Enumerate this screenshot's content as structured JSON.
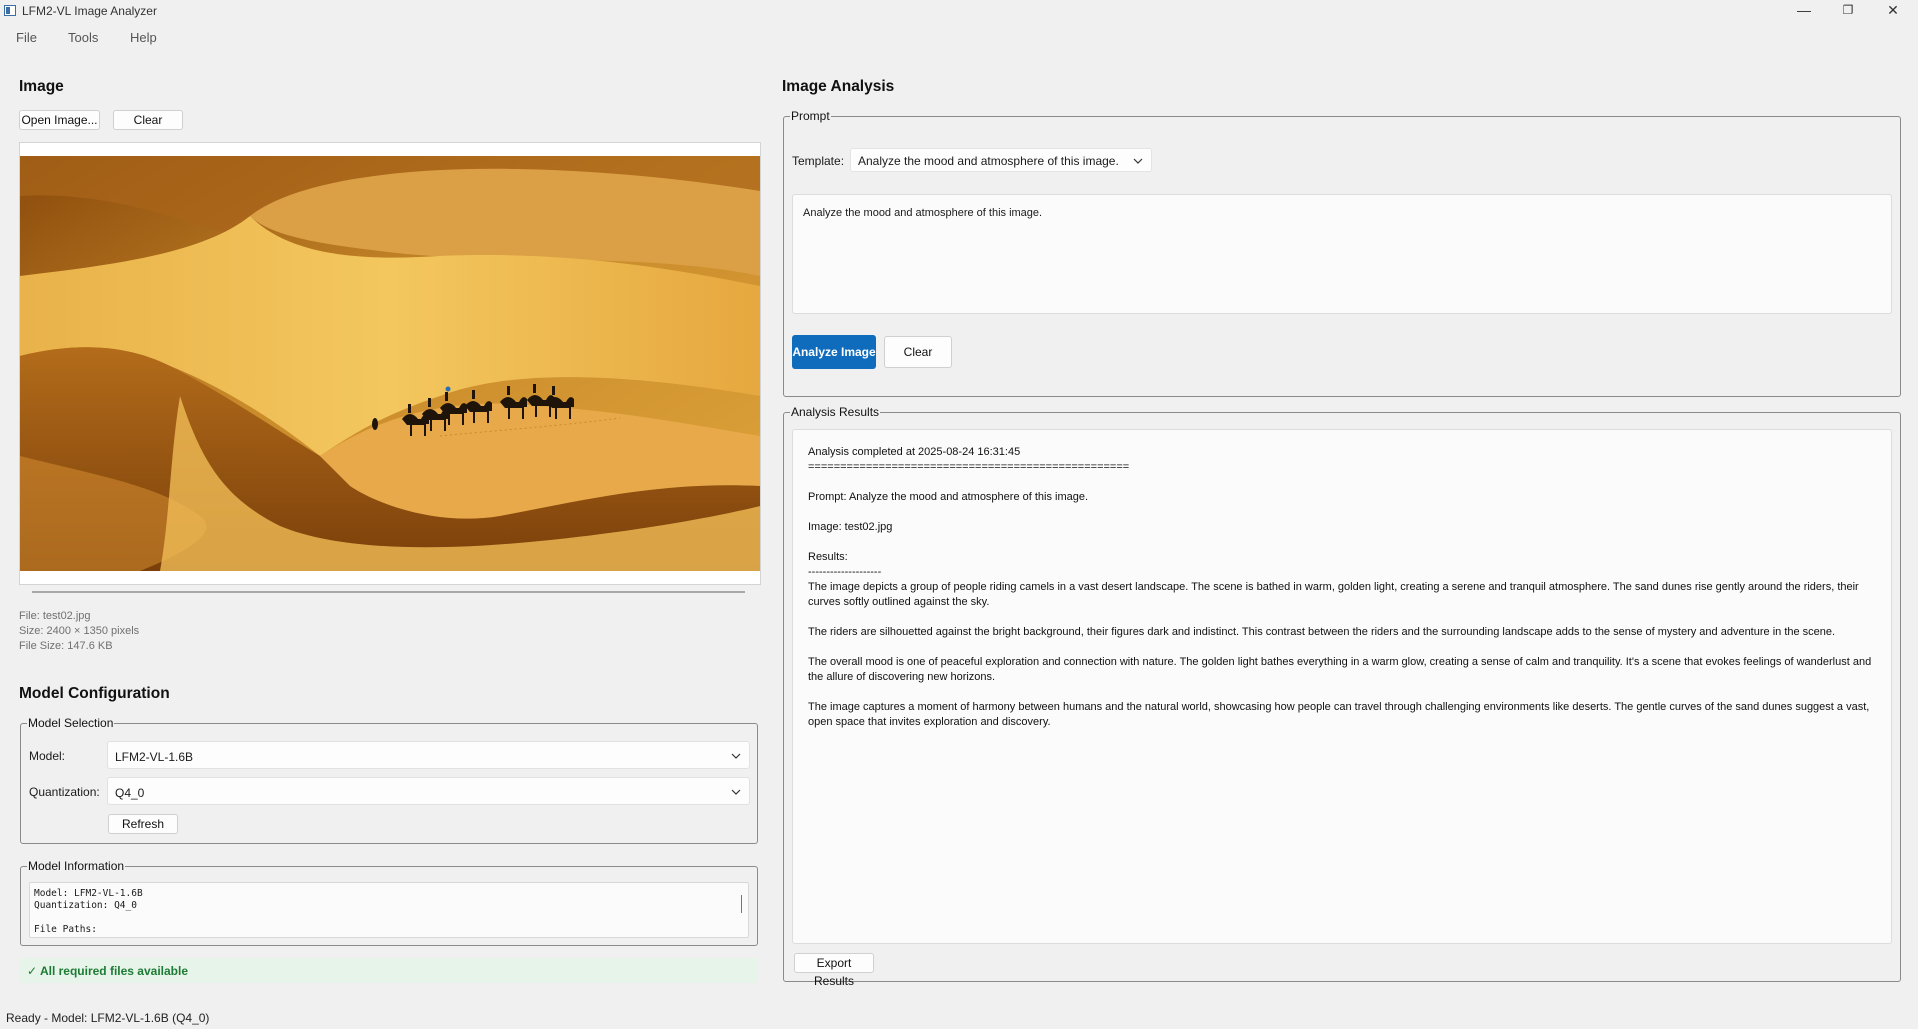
{
  "window": {
    "title": "LFM2-VL Image Analyzer",
    "minimize_glyph": "—",
    "maximize_glyph": "❐",
    "close_glyph": "✕"
  },
  "menu": [
    "File",
    "Tools",
    "Help"
  ],
  "image_panel": {
    "title": "Image",
    "open_label": "Open Image...",
    "clear_label": "Clear",
    "file": "File: test02.jpg",
    "size": "Size: 2400 × 1350 pixels",
    "file_size": "File Size: 147.6 KB"
  },
  "model_config": {
    "title": "Model Configuration",
    "selection_group": "Model Selection",
    "model_label": "Model:",
    "model_value": "LFM2-VL-1.6B",
    "quant_label": "Quantization:",
    "quant_value": "Q4_0",
    "refresh_label": "Refresh",
    "info_group": "Model Information",
    "info_lines": [
      "Model: LFM2-VL-1.6B",
      "Quantization: Q4_0",
      "",
      "File Paths:"
    ],
    "status": "✓ All required files available"
  },
  "analysis": {
    "title": "Image Analysis",
    "prompt_group": "Prompt",
    "template_label": "Template:",
    "template_value": "Analyze the mood and atmosphere of this image.",
    "prompt_text": "Analyze the mood and atmosphere of this image.",
    "analyze_label": "Analyze Image",
    "clear_label": "Clear",
    "results_group": "Analysis Results",
    "results": {
      "completed": "Analysis completed at 2025-08-24 16:31:45",
      "separator": "==================================================",
      "prompt": "Prompt: Analyze the mood and atmosphere of this image.",
      "image": "Image: test02.jpg",
      "results_label": "Results:",
      "dashes": "--------------------",
      "paragraphs": [
        "The image depicts a group of people riding camels in a vast desert landscape. The scene is bathed in warm, golden light, creating a serene and tranquil atmosphere. The sand dunes rise gently around the riders, their curves softly outlined against the sky.",
        "The riders are silhouetted against the bright background, their figures dark and indistinct. This contrast between the riders and the surrounding landscape adds to the sense of mystery and adventure in the scene.",
        "The overall mood is one of peaceful exploration and connection with nature. The golden light bathes everything in a warm glow, creating a sense of calm and tranquility. It's a scene that evokes feelings of wanderlust and the allure of discovering new horizons.",
        "The image captures a moment of harmony between humans and the natural world, showcasing how people can travel through challenging environments like deserts. The gentle curves of the sand dunes suggest a vast, open space that invites exploration and discovery."
      ]
    },
    "export_label": "Export Results"
  },
  "statusbar": "Ready - Model: LFM2-VL-1.6B (Q4_0)",
  "colors": {
    "accent": "#0f6cbd",
    "success_text": "#1e7b34",
    "success_bg": "#e6f4ea"
  }
}
